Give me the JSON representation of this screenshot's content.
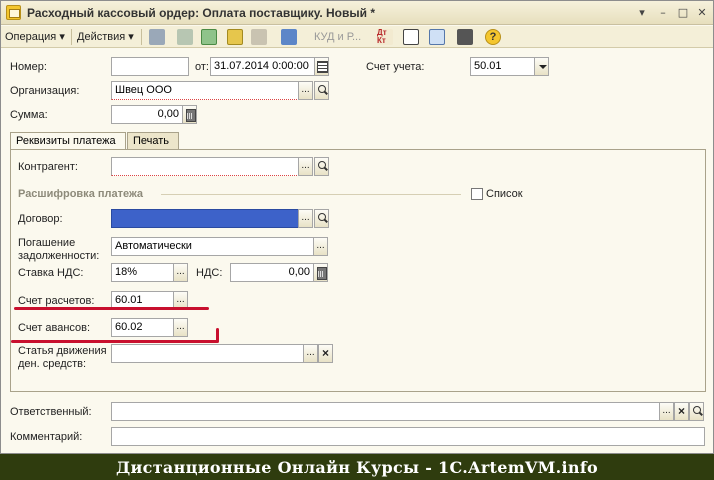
{
  "window": {
    "title": "Расходный кассовый ордер: Оплата поставщику. Новый *",
    "controls": {
      "menu": "▾",
      "minimize": "–",
      "maximize": "□",
      "close": "✕"
    }
  },
  "toolbar": {
    "operation_label": "Операция",
    "actions_label": "Действия",
    "kud_label": "КУД и Р...",
    "dt_kt_label": "Дт Кт"
  },
  "header": {
    "number_label": "Номер:",
    "number_value": "",
    "date_label": "от:",
    "date_value": "31.07.2014  0:00:00",
    "account_label": "Счет учета:",
    "account_value": "50.01",
    "organization_label": "Организация:",
    "organization_value": "Швец ООО",
    "sum_label": "Сумма:",
    "sum_value": "0,00"
  },
  "tabs": [
    {
      "label": "Реквизиты платежа"
    },
    {
      "label": "Печать"
    }
  ],
  "payment": {
    "counterparty_label": "Контрагент:",
    "counterparty_value": "",
    "section_title": "Расшифровка платежа",
    "list_label": "Список",
    "contract_label": "Договор:",
    "contract_value": "",
    "repayment_label_1": "Погашение",
    "repayment_label_2": "задолженности:",
    "repayment_value": "Автоматически",
    "vat_rate_label": "Ставка НДС:",
    "vat_rate_value": "18%",
    "vat_label": "НДС:",
    "vat_value": "0,00",
    "settlement_account_label": "Счет расчетов:",
    "settlement_account_value": "60.01",
    "advance_account_label": "Счет авансов:",
    "advance_account_value": "60.02",
    "cashflow_label_1": "Статья движения",
    "cashflow_label_2": "ден. средств:",
    "cashflow_value": ""
  },
  "bottom": {
    "responsible_label": "Ответственный:",
    "responsible_value": "",
    "comment_label": "Комментарий:",
    "comment_value": ""
  },
  "footer": {
    "text": "Дистанционные Онлайн Курсы - 1C.ArtemVM.info"
  },
  "colors": {
    "accent_red": "#c8102e",
    "selection_blue": "#3d62c9",
    "footer_bg": "#2f3c0e"
  }
}
